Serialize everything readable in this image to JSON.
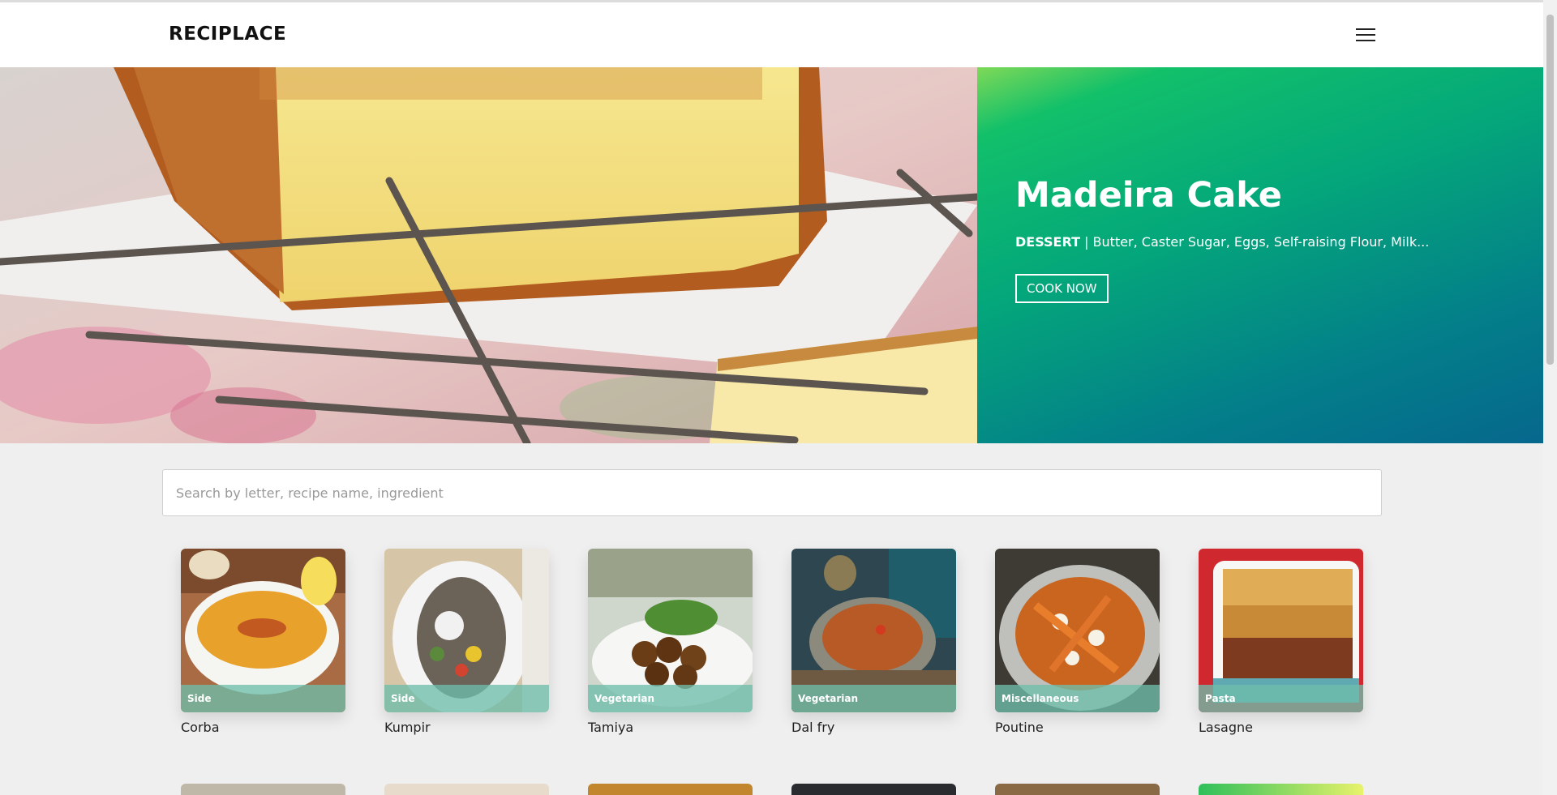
{
  "navbar": {
    "brand": "RECIPLACE",
    "menu_icon": "hamburger-menu-icon"
  },
  "hero": {
    "title": "Madeira Cake",
    "category": "DESSERT",
    "separator": " | ",
    "ingredients": "Butter, Caster Sugar, Eggs, Self-raising Flour, Milk...",
    "button_label": "COOK NOW",
    "image": "madeira-cake-photo"
  },
  "search": {
    "placeholder": "Search by letter, recipe name, ingredient",
    "value": ""
  },
  "recipes": [
    {
      "name": "Corba",
      "category": "Side"
    },
    {
      "name": "Kumpir",
      "category": "Side"
    },
    {
      "name": "Tamiya",
      "category": "Vegetarian"
    },
    {
      "name": "Dal fry",
      "category": "Vegetarian"
    },
    {
      "name": "Poutine",
      "category": "Miscellaneous"
    },
    {
      "name": "Lasagne",
      "category": "Pasta"
    }
  ],
  "colors": {
    "hero_gradient_start": "#7ed957",
    "hero_gradient_mid": "#04a87a",
    "hero_gradient_end": "#06678d",
    "tag_overlay": "#6ebeaa"
  }
}
